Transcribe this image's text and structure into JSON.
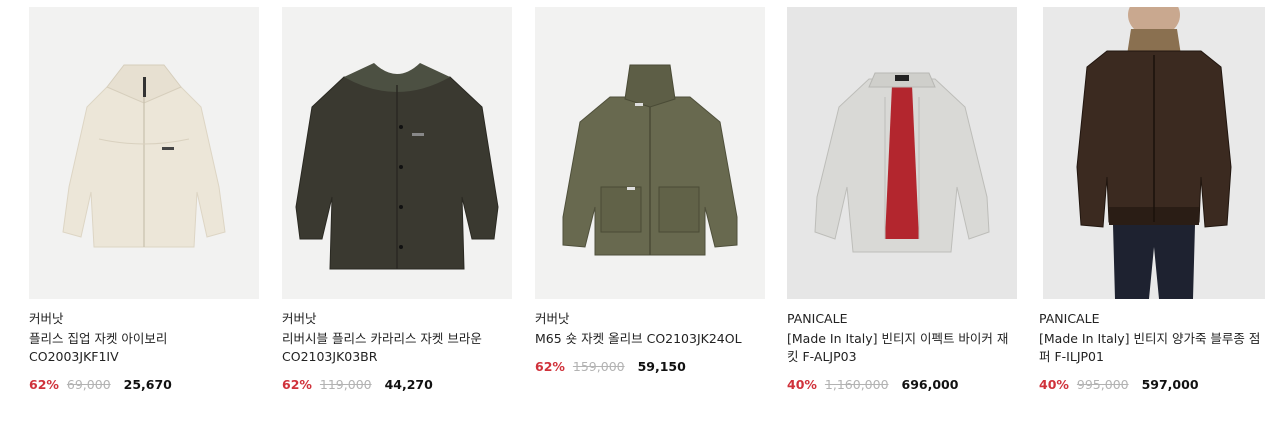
{
  "products": [
    {
      "brand": "커버낫",
      "name_line1": "플리스 집업 자켓 아이보리",
      "name_line2": "CO2003JKF1IV",
      "discount": "62%",
      "original_price": "69,000",
      "sale_price": "25,670",
      "image_icon": "ivory-fleece-zip-jacket-image"
    },
    {
      "brand": "커버낫",
      "name_line1": "리버시블 플리스 카라리스 자켓 브라운",
      "name_line2": "CO2103JK03BR",
      "discount": "62%",
      "original_price": "119,000",
      "sale_price": "44,270",
      "image_icon": "brown-reversible-fleece-jacket-image"
    },
    {
      "brand": "커버낫",
      "name_line1": "M65 숏 자켓 올리브 CO2103JK24OL",
      "name_line2": "",
      "discount": "62%",
      "original_price": "159,000",
      "sale_price": "59,150",
      "image_icon": "olive-m65-short-jacket-image"
    },
    {
      "brand": "PANICALE",
      "name_line1": "[Made In Italy] 빈티지 이펙트 바이커 재",
      "name_line2": "킷 F-ALJP03",
      "discount": "40%",
      "original_price": "1,160,000",
      "sale_price": "696,000",
      "image_icon": "white-leather-biker-jacket-image"
    },
    {
      "brand": "PANICALE",
      "name_line1": "[Made In Italy] 빈티지 양가죽 블루종 점",
      "name_line2": "퍼 F-ILJP01",
      "discount": "40%",
      "original_price": "995,000",
      "sale_price": "597,000",
      "image_icon": "brown-leather-blouson-image"
    }
  ],
  "colors": {
    "discount": "#d0323b",
    "original_price": "#b3b3b3",
    "sale_price": "#111111"
  }
}
